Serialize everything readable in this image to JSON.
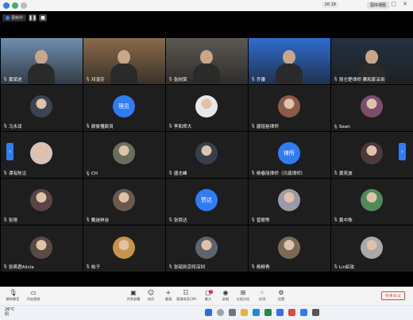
{
  "topbar": {
    "clock": "26:18",
    "view_label": "图库视图",
    "window_controls": "— ▢ ✕"
  },
  "meeting": {
    "recording_label": "录制中",
    "pause_label": "❚❚",
    "stop_label": "■"
  },
  "participants": [
    {
      "name": "黄荣进",
      "type": "photo",
      "bg": "#6f8fb0"
    },
    {
      "name": "邓凌芬",
      "type": "photo",
      "bg": "#8a6b4c"
    },
    {
      "name": "张树荣",
      "type": "photo",
      "bg": "#5c5a52"
    },
    {
      "name": "齐骥",
      "type": "photo",
      "bg": "#2f6dd0"
    },
    {
      "name": "昆仑楚律师 赛和家深圳",
      "type": "photo",
      "bg": "#24313f"
    },
    {
      "name": "马永双",
      "type": "avatar",
      "bg": "#3a4452"
    },
    {
      "name": "颜俊懂颜员",
      "type": "text",
      "avatar_text": "理员"
    },
    {
      "name": "李和郑大",
      "type": "avatar",
      "bg": "#e8e8e8"
    },
    {
      "name": "唐铭裕律师",
      "type": "avatar",
      "bg": "#8a5a4a"
    },
    {
      "name": "Sean",
      "type": "avatar",
      "bg": "#7b4d6f"
    },
    {
      "name": "谭有陈见",
      "type": "avatar",
      "bg": "#d9c3b5"
    },
    {
      "name": "CH",
      "type": "avatar",
      "bg": "#6a6e5d"
    },
    {
      "name": "唐志峰",
      "type": "avatar",
      "bg": "#36404a"
    },
    {
      "name": "杨春丽律师（贝鹃律师）",
      "type": "text",
      "avatar_text": "律所"
    },
    {
      "name": "黄奕波",
      "type": "avatar",
      "bg": "#4a3a3a"
    },
    {
      "name": "张艳",
      "type": "avatar",
      "bg": "#5a4444"
    },
    {
      "name": "戴迷林谷",
      "type": "avatar",
      "bg": "#6b5a4b"
    },
    {
      "name": "张赞达",
      "type": "text",
      "avatar_text": "赞达"
    },
    {
      "name": "曾聪等",
      "type": "avatar",
      "bg": "#9a9aa8"
    },
    {
      "name": "黄中珠",
      "type": "avatar",
      "bg": "#4f8a5a"
    },
    {
      "name": "张燕君Alicia",
      "type": "avatar",
      "bg": "#5a4a44"
    },
    {
      "name": "柏子",
      "type": "avatar",
      "bg": "#c9934a"
    },
    {
      "name": "张韬到京晖深圳",
      "type": "avatar",
      "bg": "#5c6570"
    },
    {
      "name": "杨柳青",
      "type": "avatar",
      "bg": "#7a6a55"
    },
    {
      "name": "Lin虹玫",
      "type": "avatar",
      "bg": "#a9a9a9"
    }
  ],
  "toolbar": {
    "items_left": [
      {
        "label": "解除静音",
        "icon": "mic-icon"
      },
      {
        "label": "开启视频",
        "icon": "camera-icon"
      }
    ],
    "items_center": [
      {
        "label": "共享屏幕",
        "icon": "share-screen-icon"
      },
      {
        "label": "成员",
        "icon": "members-icon"
      },
      {
        "label": "邀请",
        "icon": "invite-icon"
      },
      {
        "label": "管理成员(39)",
        "icon": "manage-members-icon"
      },
      {
        "label": "聊天",
        "icon": "chat-icon"
      },
      {
        "label": "录制",
        "icon": "record-icon"
      },
      {
        "label": "分组讨论",
        "icon": "breakout-icon"
      },
      {
        "label": "应用",
        "icon": "apps-icon"
      },
      {
        "label": "设置",
        "icon": "settings-icon"
      }
    ],
    "chat_badge": "1",
    "end_label": "结束会议"
  },
  "taskbar": {
    "weather_temp": "26°C",
    "weather_desc": "阴"
  },
  "colors": {
    "accent": "#2f7cf6",
    "end_red": "#e03a3a"
  }
}
